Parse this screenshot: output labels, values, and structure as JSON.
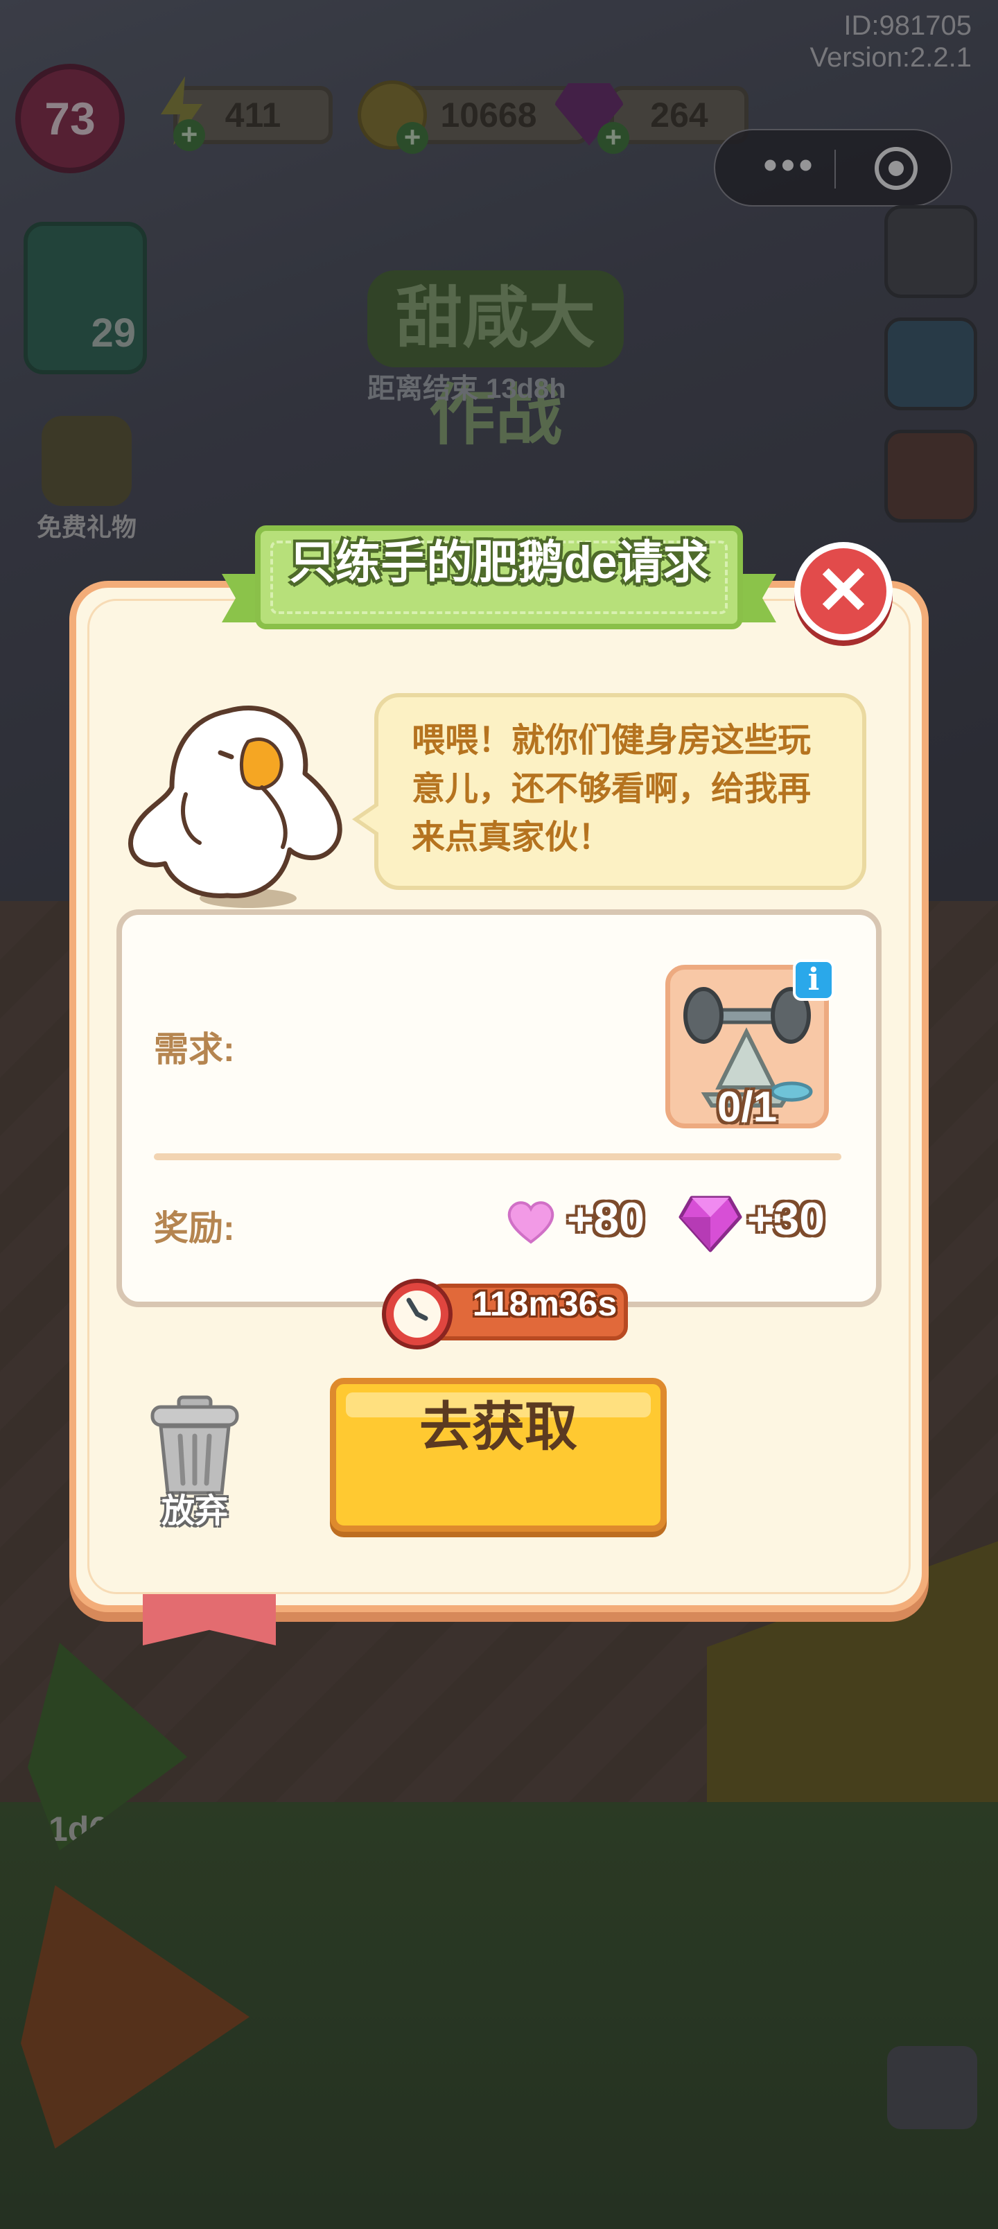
{
  "hud": {
    "level": "73",
    "energy": "411",
    "coins": "10668",
    "gems": "264",
    "plus": "+",
    "id_text": "ID:981705",
    "version_text": "Version:2.2.1",
    "menu_dots": "•••"
  },
  "side": {
    "left_card_count": "29",
    "free_gift_label": "免费礼物",
    "event_logo": "甜咸大作战",
    "event_countdown": "距离结束 13d8h",
    "bottom_timer": "1d6h"
  },
  "dialog": {
    "title": "只练手的肥鹅de请求",
    "close_symbol": "✕",
    "speech": "喂喂！就你们健身房这些玩意儿，还不够看啊，给我再来点真家伙！",
    "request_label": "需求:",
    "request_item": {
      "icon": "barbell-rack-icon",
      "progress": "0/1"
    },
    "info_symbol": "i",
    "reward_label": "奖励:",
    "rewards": {
      "heart": "+80",
      "gem": "+30"
    },
    "timer": "118m36s",
    "abandon_label": "放弃",
    "go_button": "去获取"
  },
  "colors": {
    "dialog_bg": "#fdf6e2",
    "dialog_border": "#f3ad79",
    "title_green": "#b7e07a",
    "close_red": "#e24b4b",
    "go_yellow": "#ffc931",
    "timer_orange": "#e1693a"
  }
}
